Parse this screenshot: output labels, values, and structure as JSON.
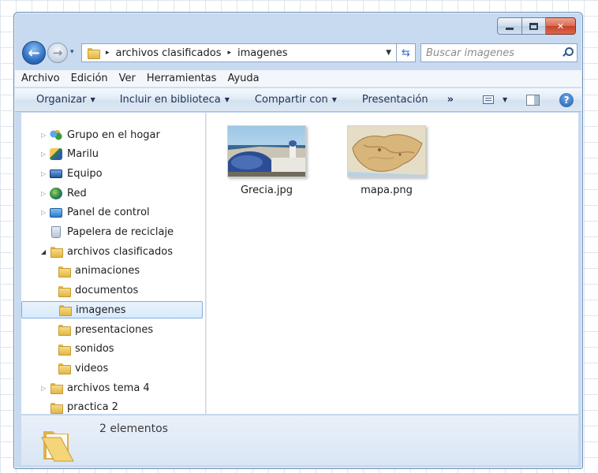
{
  "window": {
    "caption_buttons": {
      "minimize_icon": "minimize-icon",
      "maximize_icon": "maximize-icon",
      "close_label": "✕"
    }
  },
  "navigation": {
    "back_glyph": "←",
    "forward_glyph": "→",
    "recent_glyph": "▾",
    "breadcrumb": [
      "archivos clasificados",
      "imagenes"
    ],
    "breadcrumb_sep": "▸",
    "address_dropdown": "▼",
    "refresh_glyph": "⇆",
    "search_placeholder": "Buscar imagenes"
  },
  "menubar": [
    "Archivo",
    "Edición",
    "Ver",
    "Herramientas",
    "Ayuda"
  ],
  "commandbar": {
    "organize": "Organizar",
    "include": "Incluir en biblioteca",
    "share": "Compartir con",
    "presentation": "Presentación",
    "more": "»",
    "help": "?",
    "caret": "▼"
  },
  "tree": [
    {
      "label": "Grupo en el hogar",
      "icon": "homegroup-icon",
      "expander": "▷"
    },
    {
      "label": "Marilu",
      "icon": "user-icon",
      "expander": "▷"
    },
    {
      "label": "Equipo",
      "icon": "computer-icon",
      "expander": "▷"
    },
    {
      "label": "Red",
      "icon": "network-icon",
      "expander": "▷"
    },
    {
      "label": "Panel de control",
      "icon": "control-panel-icon",
      "expander": "▷"
    },
    {
      "label": "Papelera de reciclaje",
      "icon": "recycle-bin-icon",
      "expander": ""
    },
    {
      "label": "archivos clasificados",
      "icon": "folder-icon",
      "expander": "◢"
    },
    {
      "label": "animaciones",
      "icon": "folder-icon",
      "expander": ""
    },
    {
      "label": "documentos",
      "icon": "folder-icon",
      "expander": ""
    },
    {
      "label": "imagenes",
      "icon": "folder-icon",
      "expander": "",
      "selected": true
    },
    {
      "label": "presentaciones",
      "icon": "folder-icon",
      "expander": ""
    },
    {
      "label": "sonidos",
      "icon": "folder-icon",
      "expander": ""
    },
    {
      "label": "videos",
      "icon": "folder-icon",
      "expander": ""
    },
    {
      "label": "archivos tema 4",
      "icon": "folder-icon",
      "expander": "▷"
    },
    {
      "label": "practica 2",
      "icon": "folder-icon",
      "expander": ""
    }
  ],
  "scrollbar": {
    "up": "▲",
    "down": "▼"
  },
  "files": [
    {
      "name": "Grecia.jpg",
      "thumbnail": "greece-photo-thumbnail"
    },
    {
      "name": "mapa.png",
      "thumbnail": "map-thumbnail"
    }
  ],
  "details": {
    "count": "2 elementos"
  },
  "colors": {
    "selection": "#d8eafc",
    "window_frame": "#c7daf0",
    "accent": "#2f6fc2"
  }
}
